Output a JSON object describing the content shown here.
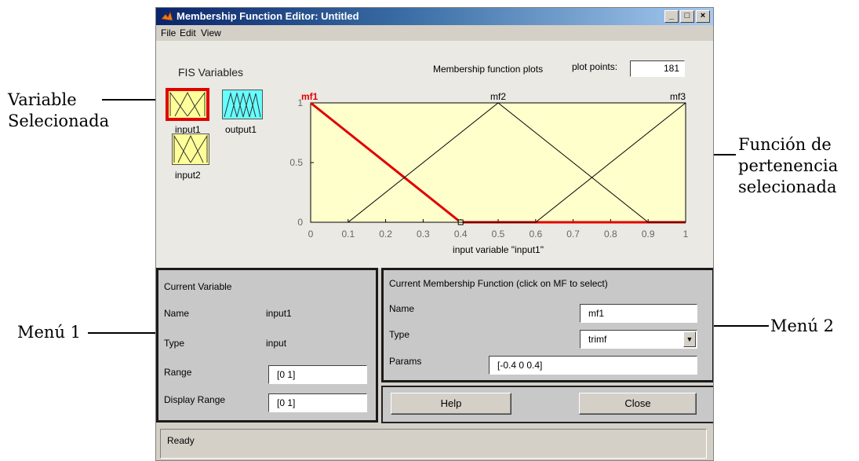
{
  "window": {
    "title": "Membership Function Editor: Untitled"
  },
  "menu": [
    "File",
    "Edit",
    "View"
  ],
  "fis": {
    "title": "FIS Variables",
    "variables": [
      {
        "label": "input1",
        "kind": "input",
        "selected": true
      },
      {
        "label": "output1",
        "kind": "output",
        "selected": false
      },
      {
        "label": "input2",
        "kind": "input",
        "selected": false
      }
    ]
  },
  "plot": {
    "heading": "Membership function plots",
    "plot_points_label": "plot points:",
    "plot_points_value": "181",
    "xlabel": "input variable \"input1\"",
    "selected_color": "#e00000"
  },
  "chart_data": {
    "type": "line",
    "xlabel": "input variable \"input1\"",
    "ylabel": "",
    "xlim": [
      0,
      1
    ],
    "ylim": [
      0,
      1
    ],
    "x_ticks": [
      "0",
      "0.1",
      "0.2",
      "0.3",
      "0.4",
      "0.5",
      "0.6",
      "0.7",
      "0.8",
      "0.9",
      "1"
    ],
    "y_ticks": [
      "0",
      "0.5",
      "1"
    ],
    "series": [
      {
        "name": "mf1",
        "params": [
          -0.4,
          0,
          0.4
        ],
        "selected": true
      },
      {
        "name": "mf2",
        "params": [
          0.1,
          0.5,
          0.9
        ],
        "selected": false
      },
      {
        "name": "mf3",
        "params": [
          0.6,
          1,
          1.4
        ],
        "selected": false
      }
    ]
  },
  "current_variable": {
    "title": "Current Variable",
    "name_label": "Name",
    "name_value": "input1",
    "type_label": "Type",
    "type_value": "input",
    "range_label": "Range",
    "range_value": "[0 1]",
    "display_range_label": "Display Range",
    "display_range_value": "[0 1]"
  },
  "current_mf": {
    "title": "Current Membership Function (click on MF to select)",
    "name_label": "Name",
    "name_value": "mf1",
    "type_label": "Type",
    "type_value": "trimf",
    "params_label": "Params",
    "params_value": "[-0.4 0 0.4]"
  },
  "buttons": {
    "help": "Help",
    "close": "Close"
  },
  "status": "Ready",
  "annotations": {
    "variable_line1": "Variable",
    "variable_line2": "Selecionada",
    "function_line1": "Función de",
    "function_line2": "pertenencia",
    "function_line3": "selecionada",
    "menu1": "Menú 1",
    "menu2": "Menú 2"
  }
}
